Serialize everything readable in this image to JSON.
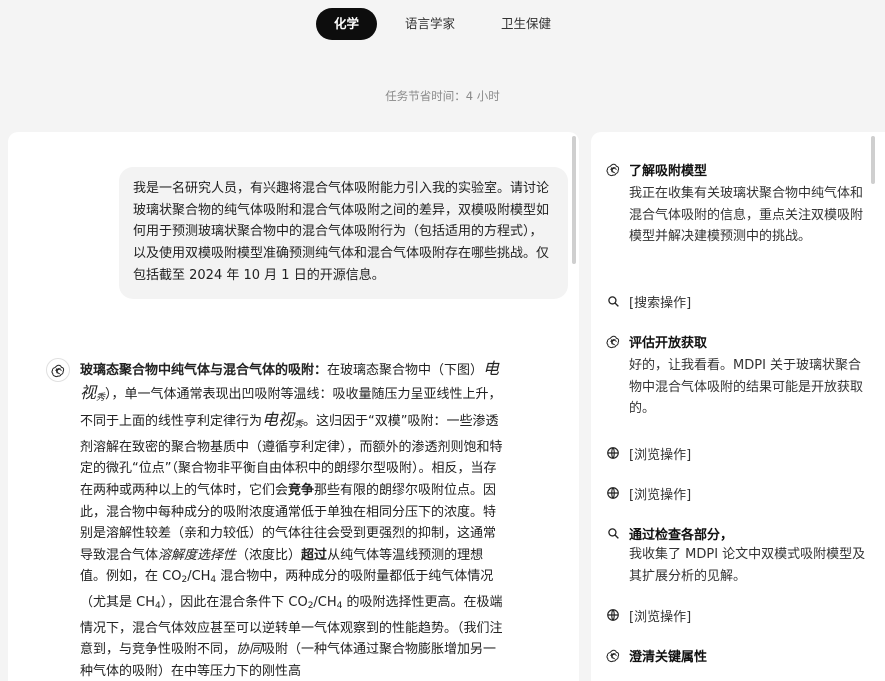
{
  "tabs": [
    {
      "label": "化学",
      "active": true
    },
    {
      "label": "语言学家",
      "active": false
    },
    {
      "label": "卫生保健",
      "active": false
    }
  ],
  "time_saved": "任务节省时间：4 小时",
  "user_message": "我是一名研究人员，有兴趣将混合气体吸附能力引入我的实验室。请讨论玻璃状聚合物的纯气体吸附和混合气体吸附之间的差异，双模吸附模型如何用于预测玻璃状聚合物中的混合气体吸附行为（包括适用的方程式），以及使用双模吸附模型准确预测纯气体和混合气体吸附存在哪些挑战。仅包括截至 2024 年 10 月 1 日的开源信息。",
  "assistant": {
    "heading": "玻璃态聚合物中纯气体与混合气体的吸附：",
    "p1": "在玻璃态聚合物中（下图）",
    "view_fig": "电视",
    "view_sub": "秀",
    "p2": "），单一气体通常表现出凹吸附等温线：吸收量随压力呈亚线性上升，不同于上面的线性亨利定律行为",
    "p3": "。这归因于“双模”吸附：一些渗透剂溶解在致密的聚合物基质中（遵循亨利定律），而额外的渗透剂则饱和特定的微孔“位点”（聚合物非平衡自由体积中的朗缪尔型吸附）。相反，当存在两种或两种以上的气体时，它们会",
    "compete": "竞争",
    "p4": "那些有限的朗缪尔吸附位点。因此，混合物中每种成分的吸附浓度通常低于单独在相同分压下的浓度。特别是溶解性较差（亲和力较低）的气体往往会受到更强烈的抑制，这通常导致混合气体",
    "solubility_selectivity": "溶解度选择性",
    "p5": "（浓度比）",
    "exceeds": "超过",
    "p6": "从纯气体等温线预测的理想值。例如，在 CO",
    "co2_sub": "2",
    "p7": "/CH",
    "ch4_sub": "4",
    "p8": " 混合物中，两种成分的吸附量都低于纯气体情况（尤其是 CH",
    "p9": "），因此在混合条件下 CO",
    "p10": "/CH",
    "p11": " 的吸附选择性更高。在极端情况下，混合气体效应甚至可以逆转单一气体观察到的性能趋势。（我们注意到，与竞争性吸附不同，",
    "cooperative": "协同",
    "p12": "吸附（一种气体通过聚合物膨胀增加另一种气体的吸附）在中等压力下的刚性高"
  },
  "activity": [
    {
      "type": "think",
      "icon": "openai-icon",
      "title": "了解吸附模型",
      "body": "我正在收集有关玻璃状聚合物中纯气体和混合气体吸附的信息，重点关注双模吸附模型并解决建模预测中的挑战。"
    },
    {
      "type": "action",
      "icon": "search-icon",
      "title": "[搜索操作]"
    },
    {
      "type": "think",
      "icon": "openai-icon",
      "title": "评估开放获取",
      "body": "好的，让我看看。MDPI 关于玻璃状聚合物中混合气体吸附的结果可能是开放获取的。"
    },
    {
      "type": "action",
      "icon": "globe-icon",
      "title": "[浏览操作]"
    },
    {
      "type": "action",
      "icon": "globe-icon",
      "title": "[浏览操作]"
    },
    {
      "type": "think",
      "icon": "search-icon",
      "title": "通过检查各部分，",
      "body": "我收集了 MDPI 论文中双模式吸附模型及其扩展分析的见解。"
    },
    {
      "type": "action",
      "icon": "globe-icon",
      "title": "[浏览操作]"
    },
    {
      "type": "think",
      "icon": "openai-icon",
      "title": "澄清关键属性"
    }
  ]
}
